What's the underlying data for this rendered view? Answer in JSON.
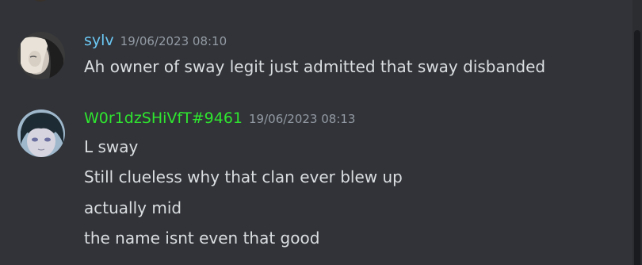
{
  "messages": [
    {
      "username": "sylv",
      "username_color": "#6cc8f4",
      "timestamp": "19/06/2023 08:10",
      "lines": [
        "Ah owner of sway legit just admitted that sway disbanded"
      ]
    },
    {
      "username": "W0r1dzSHiVfT#9461",
      "username_color": "#2fe52f",
      "timestamp": "19/06/2023 08:13",
      "lines": [
        "L sway",
        "Still clueless why that clan ever blew up",
        "actually mid",
        "the name isnt even that good"
      ]
    }
  ]
}
